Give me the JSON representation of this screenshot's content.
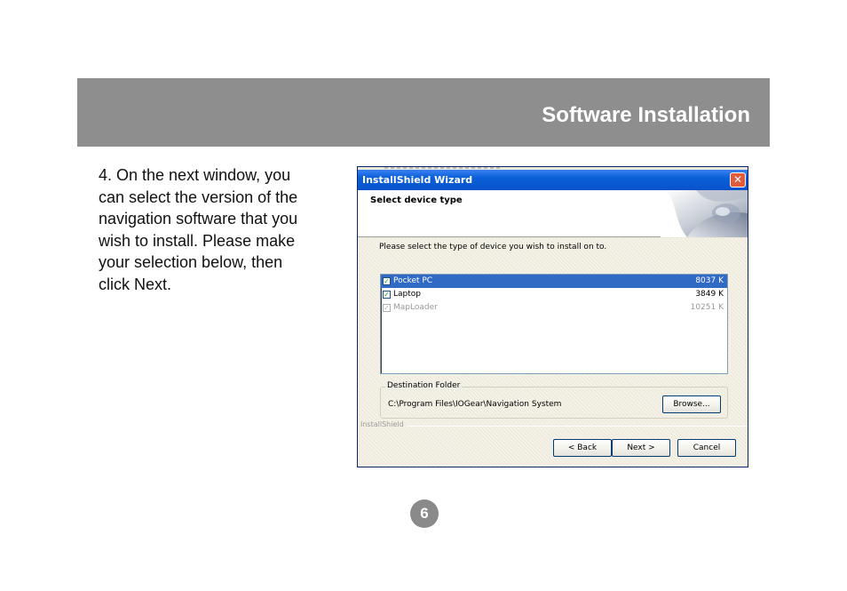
{
  "header": {
    "title": "Software Installation",
    "band_color": "#8e8e8e"
  },
  "instructions": {
    "lines": [
      "4.  On the next window, you",
      "can select the version of the",
      "navigation software that you",
      "wish to install.  Please make",
      "your selection below, then",
      "click Next."
    ]
  },
  "wizard": {
    "window_title": "InstallShield Wizard",
    "close_label": "✕",
    "banner_title": "Select device type",
    "prompt": "Please select the type of device you wish to install on to.",
    "devices": [
      {
        "name": "Pocket PC",
        "size": "8037 K",
        "checked": true,
        "selected": true,
        "enabled": true
      },
      {
        "name": "Laptop",
        "size": "3849 K",
        "checked": true,
        "selected": false,
        "enabled": true
      },
      {
        "name": "MapLoader",
        "size": "10251 K",
        "checked": true,
        "selected": false,
        "enabled": false
      }
    ],
    "destination": {
      "legend": "Destination Folder",
      "path": "C:\\Program Files\\IOGear\\Navigation System",
      "browse_label": "Browse..."
    },
    "footer_brand": "InstallShield",
    "buttons": {
      "back": "< Back",
      "next": "Next >",
      "cancel": "Cancel"
    },
    "colors": {
      "titlebar": "#0a5fd8",
      "selection": "#316ac5"
    },
    "check_glyph": "✓"
  },
  "page_number": "6"
}
